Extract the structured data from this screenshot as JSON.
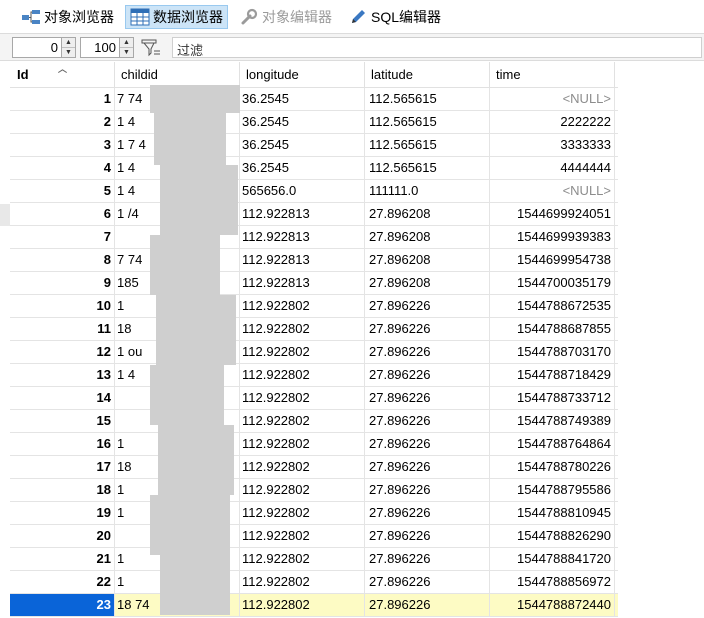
{
  "toolbar": {
    "object_browser": "对象浏览器",
    "data_browser": "数据浏览器",
    "object_editor": "对象编辑器",
    "sql_editor": "SQL编辑器"
  },
  "filter": {
    "offset": "0",
    "limit": "100",
    "filter_placeholder": "过滤"
  },
  "columns": [
    "Id",
    "childid",
    "longitude",
    "latitude",
    "time"
  ],
  "rows": [
    {
      "id": "1",
      "child": "7              74",
      "lon": "36.2545",
      "lat": "112.565615",
      "time": "<NULL>"
    },
    {
      "id": "2",
      "child": "1              4",
      "lon": "36.2545",
      "lat": "112.565615",
      "time": "2222222"
    },
    {
      "id": "3",
      "child": "1  7           4",
      "lon": "36.2545",
      "lat": "112.565615",
      "time": "3333333"
    },
    {
      "id": "4",
      "child": "1              4",
      "lon": "36.2545",
      "lat": "112.565615",
      "time": "4444444"
    },
    {
      "id": "5",
      "child": "1              4",
      "lon": "565656.0",
      "lat": "111111.0",
      "time": "<NULL>"
    },
    {
      "id": "6",
      "child": "1          /4",
      "lon": "112.922813",
      "lat": "27.896208",
      "time": "1544699924051"
    },
    {
      "id": "7",
      "child": "",
      "lon": "112.922813",
      "lat": "27.896208",
      "time": "1544699939383"
    },
    {
      "id": "8",
      "child": "7             74",
      "lon": "112.922813",
      "lat": "27.896208",
      "time": "1544699954738"
    },
    {
      "id": "9",
      "child": "185",
      "lon": "112.922813",
      "lat": "27.896208",
      "time": "1544700035179"
    },
    {
      "id": "10",
      "child": "1",
      "lon": "112.922802",
      "lat": "27.896226",
      "time": "1544788672535"
    },
    {
      "id": "11",
      "child": "18",
      "lon": "112.922802",
      "lat": "27.896226",
      "time": "1544788687855"
    },
    {
      "id": "12",
      "child": "1           ou",
      "lon": "112.922802",
      "lat": "27.896226",
      "time": "1544788703170"
    },
    {
      "id": "13",
      "child": "1             4",
      "lon": "112.922802",
      "lat": "27.896226",
      "time": "1544788718429"
    },
    {
      "id": "14",
      "child": "",
      "lon": "112.922802",
      "lat": "27.896226",
      "time": "1544788733712"
    },
    {
      "id": "15",
      "child": "",
      "lon": "112.922802",
      "lat": "27.896226",
      "time": "1544788749389"
    },
    {
      "id": "16",
      "child": "1",
      "lon": "112.922802",
      "lat": "27.896226",
      "time": "1544788764864"
    },
    {
      "id": "17",
      "child": "18",
      "lon": "112.922802",
      "lat": "27.896226",
      "time": "1544788780226"
    },
    {
      "id": "18",
      "child": "1",
      "lon": "112.922802",
      "lat": "27.896226",
      "time": "1544788795586"
    },
    {
      "id": "19",
      "child": "1",
      "lon": "112.922802",
      "lat": "27.896226",
      "time": "1544788810945"
    },
    {
      "id": "20",
      "child": "",
      "lon": "112.922802",
      "lat": "27.896226",
      "time": "1544788826290"
    },
    {
      "id": "21",
      "child": "1",
      "lon": "112.922802",
      "lat": "27.896226",
      "time": "1544788841720"
    },
    {
      "id": "22",
      "child": "1",
      "lon": "112.922802",
      "lat": "27.896226",
      "time": "1544788856972"
    },
    {
      "id": "23",
      "child": "18              74",
      "lon": "112.922802",
      "lat": "27.896226",
      "time": "1544788872440"
    }
  ],
  "selected_row": "23",
  "colors": {
    "selected_id_bg": "#0a64d8",
    "selected_row_bg": "#fdfbc4",
    "active_tab_bg": "#cce4f7",
    "null_text": "#8c8c8c"
  },
  "icons": {
    "object_browser": "object-tree-icon",
    "data_browser": "grid-table-icon",
    "object_editor": "wrench-icon",
    "sql_editor": "pencil-icon",
    "filter": "filter-funnel-icon"
  }
}
